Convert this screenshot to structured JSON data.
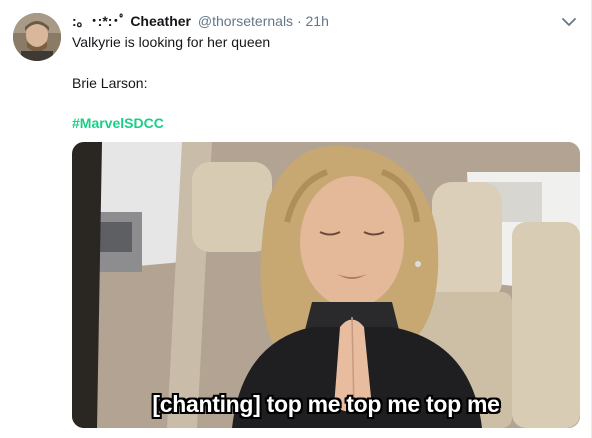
{
  "tweet": {
    "display_name": ":。･:*:･ﾟ Cheather",
    "handle": "@thorseternals",
    "separator": "·",
    "time": "21h",
    "line1": "Valkyrie is looking for her queen",
    "line2": "Brie Larson:",
    "hashtag": "#MarvelSDCC",
    "media_caption": "[chanting] top me top me top me"
  },
  "colors": {
    "hashtag": "#19cf86",
    "secondary_text": "#657786",
    "primary_text": "#14171a"
  },
  "icons": {
    "menu": "chevron-down-icon"
  }
}
